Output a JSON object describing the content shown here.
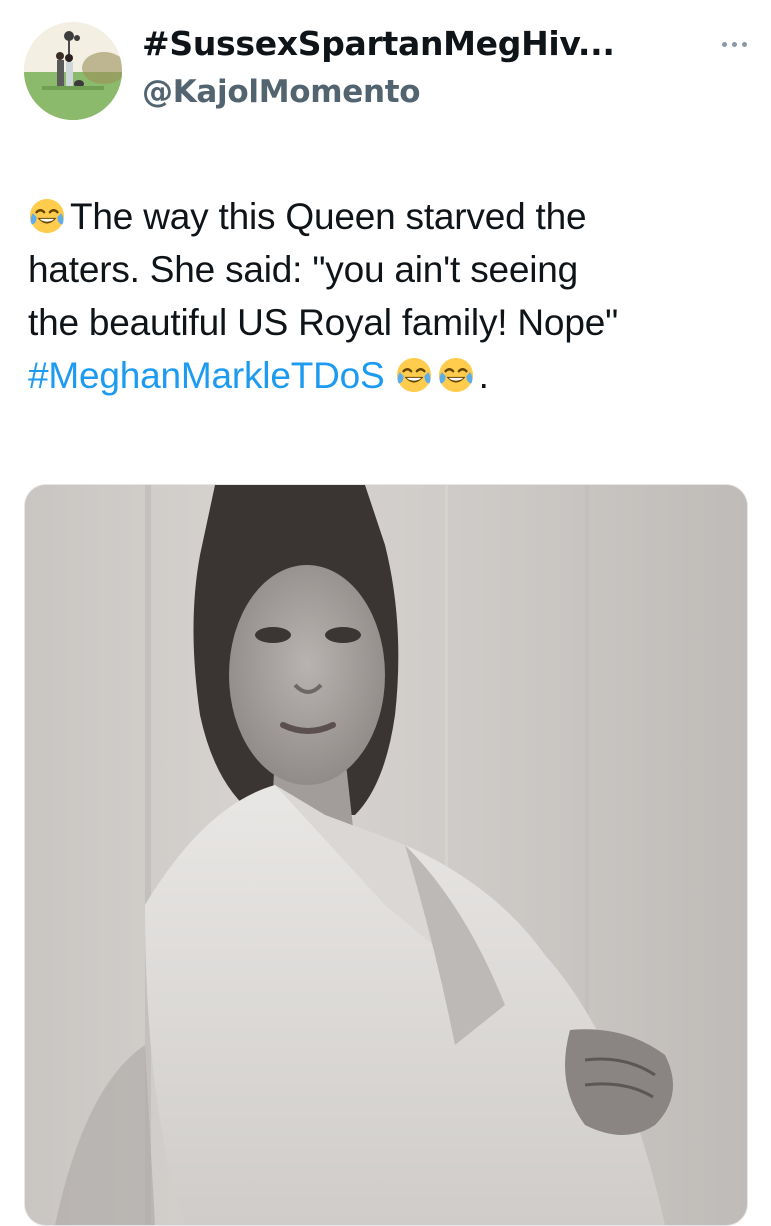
{
  "tweet": {
    "display_name": "#SussexSpartanMegHiv...",
    "handle": "@KajolMomento",
    "more_icon": "more-horizontal-icon",
    "text_lines": [
      "The way this Queen starved the",
      "haters. She said: \"you ain't seeing",
      "the beautiful US Royal family! Nope\""
    ],
    "hashtag": "#MeghanMarkleTDoS",
    "trailing_punct": ".",
    "emoji": "face-with-tears-of-joy",
    "link_color": "#1d9bf0",
    "handle_color": "#536471"
  }
}
